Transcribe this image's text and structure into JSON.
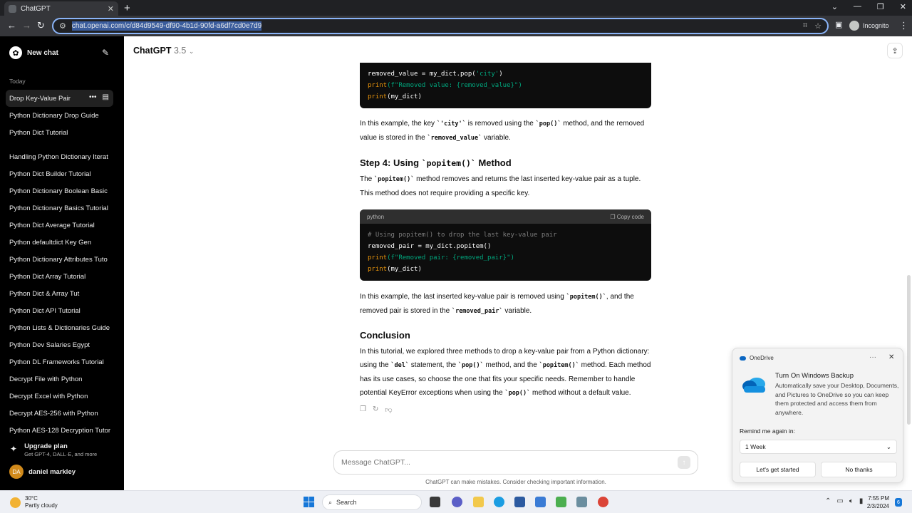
{
  "browser": {
    "tab_title": "ChatGPT",
    "url": "chat.openai.com/c/d84d9549-df90-4b1d-90fd-a6df7cd0e7d9",
    "incognito_label": "Incognito"
  },
  "sidebar": {
    "new_chat": "New chat",
    "section_label": "Today",
    "history_top": [
      "Drop Key-Value Pair",
      "Python Dictionary Drop Guide",
      "Python Dict Tutorial"
    ],
    "history_more": [
      "Handling Python Dictionary Iterat",
      "Python Dict Builder Tutorial",
      "Python Dictionary Boolean Basic",
      "Python Dictionary Basics Tutorial",
      "Python Dict Average Tutorial",
      "Python defaultdict Key Gen",
      "Python Dictionary Attributes Tuto",
      "Python Dict Array Tutorial",
      "Python Dict & Array Tut",
      "Python Dict API Tutorial",
      "Python Lists & Dictionaries Guide",
      "Python Dev Salaries Egypt",
      "Python DL Frameworks Tutorial",
      "Decrypt File with Python",
      "Decrypt Excel with Python",
      "Decrypt AES-256 with Python",
      "Python AES-128 Decryption Tutor"
    ],
    "upgrade_title": "Upgrade plan",
    "upgrade_sub": "Get GPT-4, DALL·E, and more",
    "user_initials": "DA",
    "user_name": "daniel markley"
  },
  "header": {
    "model": "ChatGPT",
    "version": "3.5"
  },
  "content": {
    "code1": {
      "line1": "removed_value = my_dict.pop(",
      "line1_str": "'city'",
      "line1_end": ")",
      "line2_fn": "print",
      "line2_str": "(f\"Removed value: {removed_value}\")",
      "line3_fn": "print",
      "line3_rest": "(my_dict)"
    },
    "p1_a": "In this example, the key ",
    "p1_code1": "`'city'`",
    "p1_b": " is removed using the ",
    "p1_code2": "`pop()`",
    "p1_c": " method, and the removed value is stored in the ",
    "p1_code3": "`removed_value`",
    "p1_d": " variable.",
    "step4_a": "Step 4: Using ",
    "step4_code": "`popitem()`",
    "step4_b": " Method",
    "p2_a": "The ",
    "p2_code": "`popitem()`",
    "p2_b": " method removes and returns the last inserted key-value pair as a tuple. This method does not require providing a specific key.",
    "code2": {
      "lang": "python",
      "copy": "Copy code",
      "comment": "# Using popitem() to drop the last key-value pair",
      "line1": "removed_pair = my_dict.popitem()",
      "line2_fn": "print",
      "line2_str": "(f\"Removed pair: {removed_pair}\")",
      "line3_fn": "print",
      "line3_rest": "(my_dict)"
    },
    "p3_a": "In this example, the last inserted key-value pair is removed using ",
    "p3_code1": "`popitem()`",
    "p3_b": ", and the removed pair is stored in the ",
    "p3_code2": "`removed_pair`",
    "p3_c": " variable.",
    "conclusion": "Conclusion",
    "p4_a": "In this tutorial, we explored three methods to drop a key-value pair from a Python dictionary: using the ",
    "p4_code1": "`del`",
    "p4_b": " statement, the ",
    "p4_code2": "`pop()`",
    "p4_c": " method, and the ",
    "p4_code3": "`popitem()`",
    "p4_d": " method. Each method has its use cases, so choose the one that fits your specific needs. Remember to handle potential KeyError exceptions when using the ",
    "p4_code4": "`pop()`",
    "p4_e": " method without a default value."
  },
  "composer": {
    "placeholder": "Message ChatGPT...",
    "disclaimer": "ChatGPT can make mistakes. Consider checking important information."
  },
  "toast": {
    "app": "OneDrive",
    "title": "Turn On Windows Backup",
    "body": "Automatically save your Desktop, Documents, and Pictures to OneDrive so you can keep them protected and access them from anywhere.",
    "remind_label": "Remind me again in:",
    "remind_value": "1 Week",
    "btn_primary": "Let's get started",
    "btn_secondary": "No thanks"
  },
  "taskbar": {
    "temp": "30°C",
    "weather": "Partly cloudy",
    "search": "Search",
    "time": "7:55 PM",
    "date": "2/3/2024",
    "notif_count": "6"
  },
  "colors": {
    "sidebar_bg": "#000000",
    "code_bg": "#0d0d0d",
    "code_string": "#00a67d",
    "code_func": "#e9950c",
    "accent": "#8ab4f8"
  }
}
